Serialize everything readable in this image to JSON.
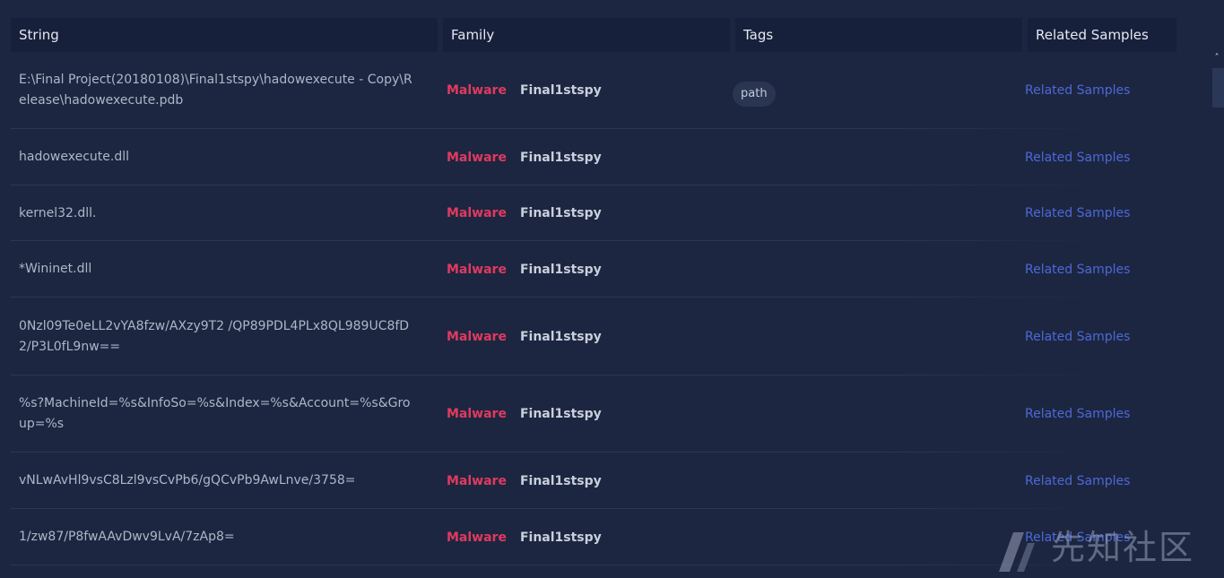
{
  "table": {
    "headers": {
      "string": "String",
      "family": "Family",
      "tags": "Tags",
      "related": "Related Samples"
    },
    "rows": [
      {
        "string": "E:\\Final Project(20180108)\\Final1stspy\\hadowexecute - Copy\\Release\\hadowexecute.pdb",
        "type": "Malware",
        "family": "Final1stspy",
        "tag": "path",
        "related": "Related Samples"
      },
      {
        "string": "hadowexecute.dll",
        "type": "Malware",
        "family": "Final1stspy",
        "tag": "",
        "related": "Related Samples"
      },
      {
        "string": "kernel32.dll.",
        "type": "Malware",
        "family": "Final1stspy",
        "tag": "",
        "related": "Related Samples"
      },
      {
        "string": "*Wininet.dll",
        "type": "Malware",
        "family": "Final1stspy",
        "tag": "",
        "related": "Related Samples"
      },
      {
        "string": "0Nzl09Te0eLL2vYA8fzw/AXzy9T2 /QP89PDL4PLx8QL989UC8fD2/P3L0fL9nw==",
        "type": "Malware",
        "family": "Final1stspy",
        "tag": "",
        "related": "Related Samples"
      },
      {
        "string": "%s?MachineId=%s&InfoSo=%s&Index=%s&Account=%s&Group=%s",
        "type": "Malware",
        "family": "Final1stspy",
        "tag": "",
        "related": "Related Samples"
      },
      {
        "string": "vNLwAvHl9vsC8Lzl9vsCvPb6/gQCvPb9AwLnve/3758=",
        "type": "Malware",
        "family": "Final1stspy",
        "tag": "",
        "related": "Related Samples"
      },
      {
        "string": "1/zw87/P8fwAAvDwv9LvA/7zAp8=",
        "type": "Malware",
        "family": "Final1stspy",
        "tag": "",
        "related": "Related Samples"
      }
    ]
  },
  "watermark": {
    "text": "先知社区"
  },
  "colors": {
    "background": "#1c2640",
    "header_bg": "#17203a",
    "malware": "#e03a5f",
    "link": "#4d68d8"
  }
}
